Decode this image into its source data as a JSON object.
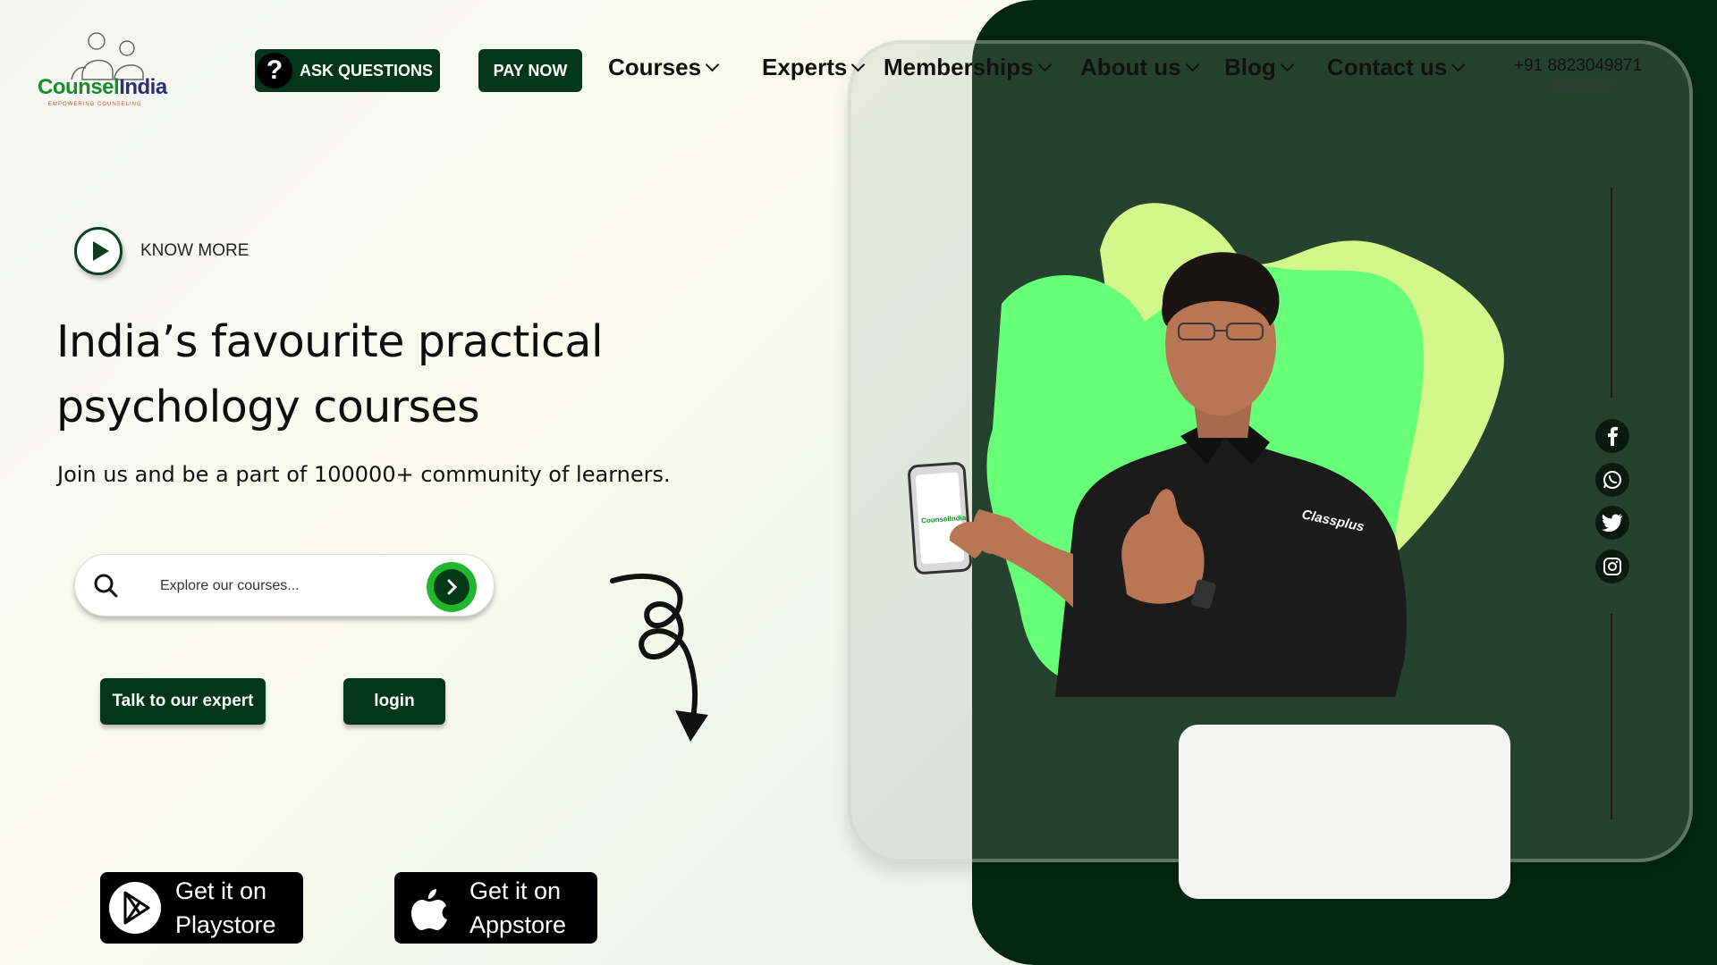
{
  "brand": {
    "name_part1": "Counsel",
    "name_part2": "India",
    "tagline": "EMPOWERING COUNSELING"
  },
  "nav": {
    "ask_label": "ASK QUESTIONS",
    "pay_label": "PAY NOW",
    "items": [
      "Courses",
      "Experts",
      "Memberships",
      "About us",
      "Blog",
      "Contact us"
    ],
    "phone": "+91 8823049871",
    "support": "Support 24/7"
  },
  "hero": {
    "know_more": "KNOW MORE",
    "title": "India’s favourite practical psychology courses",
    "subtitle": "Join us and be a part of 100000+ community of learners."
  },
  "search": {
    "placeholder": "Explore our courses..."
  },
  "actions": {
    "talk_label": "Talk to our expert",
    "login_label": "login"
  },
  "stores": {
    "playstore_line1": "Get it on",
    "playstore_line2": "Playstore",
    "appstore_line1": "Get it on",
    "appstore_line2": "Appstore"
  },
  "hero_image": {
    "shirt_text": "Classplus",
    "phone_text": "CounselIndia"
  },
  "socials": [
    "facebook-icon",
    "whatsapp-icon",
    "twitter-icon",
    "instagram-icon"
  ],
  "colors": {
    "primary_dark": "#03361a",
    "panel": "#03260f",
    "accent_green": "#22b52e",
    "blob_green": "#66ff77",
    "blob_lime": "#d4f78c"
  }
}
